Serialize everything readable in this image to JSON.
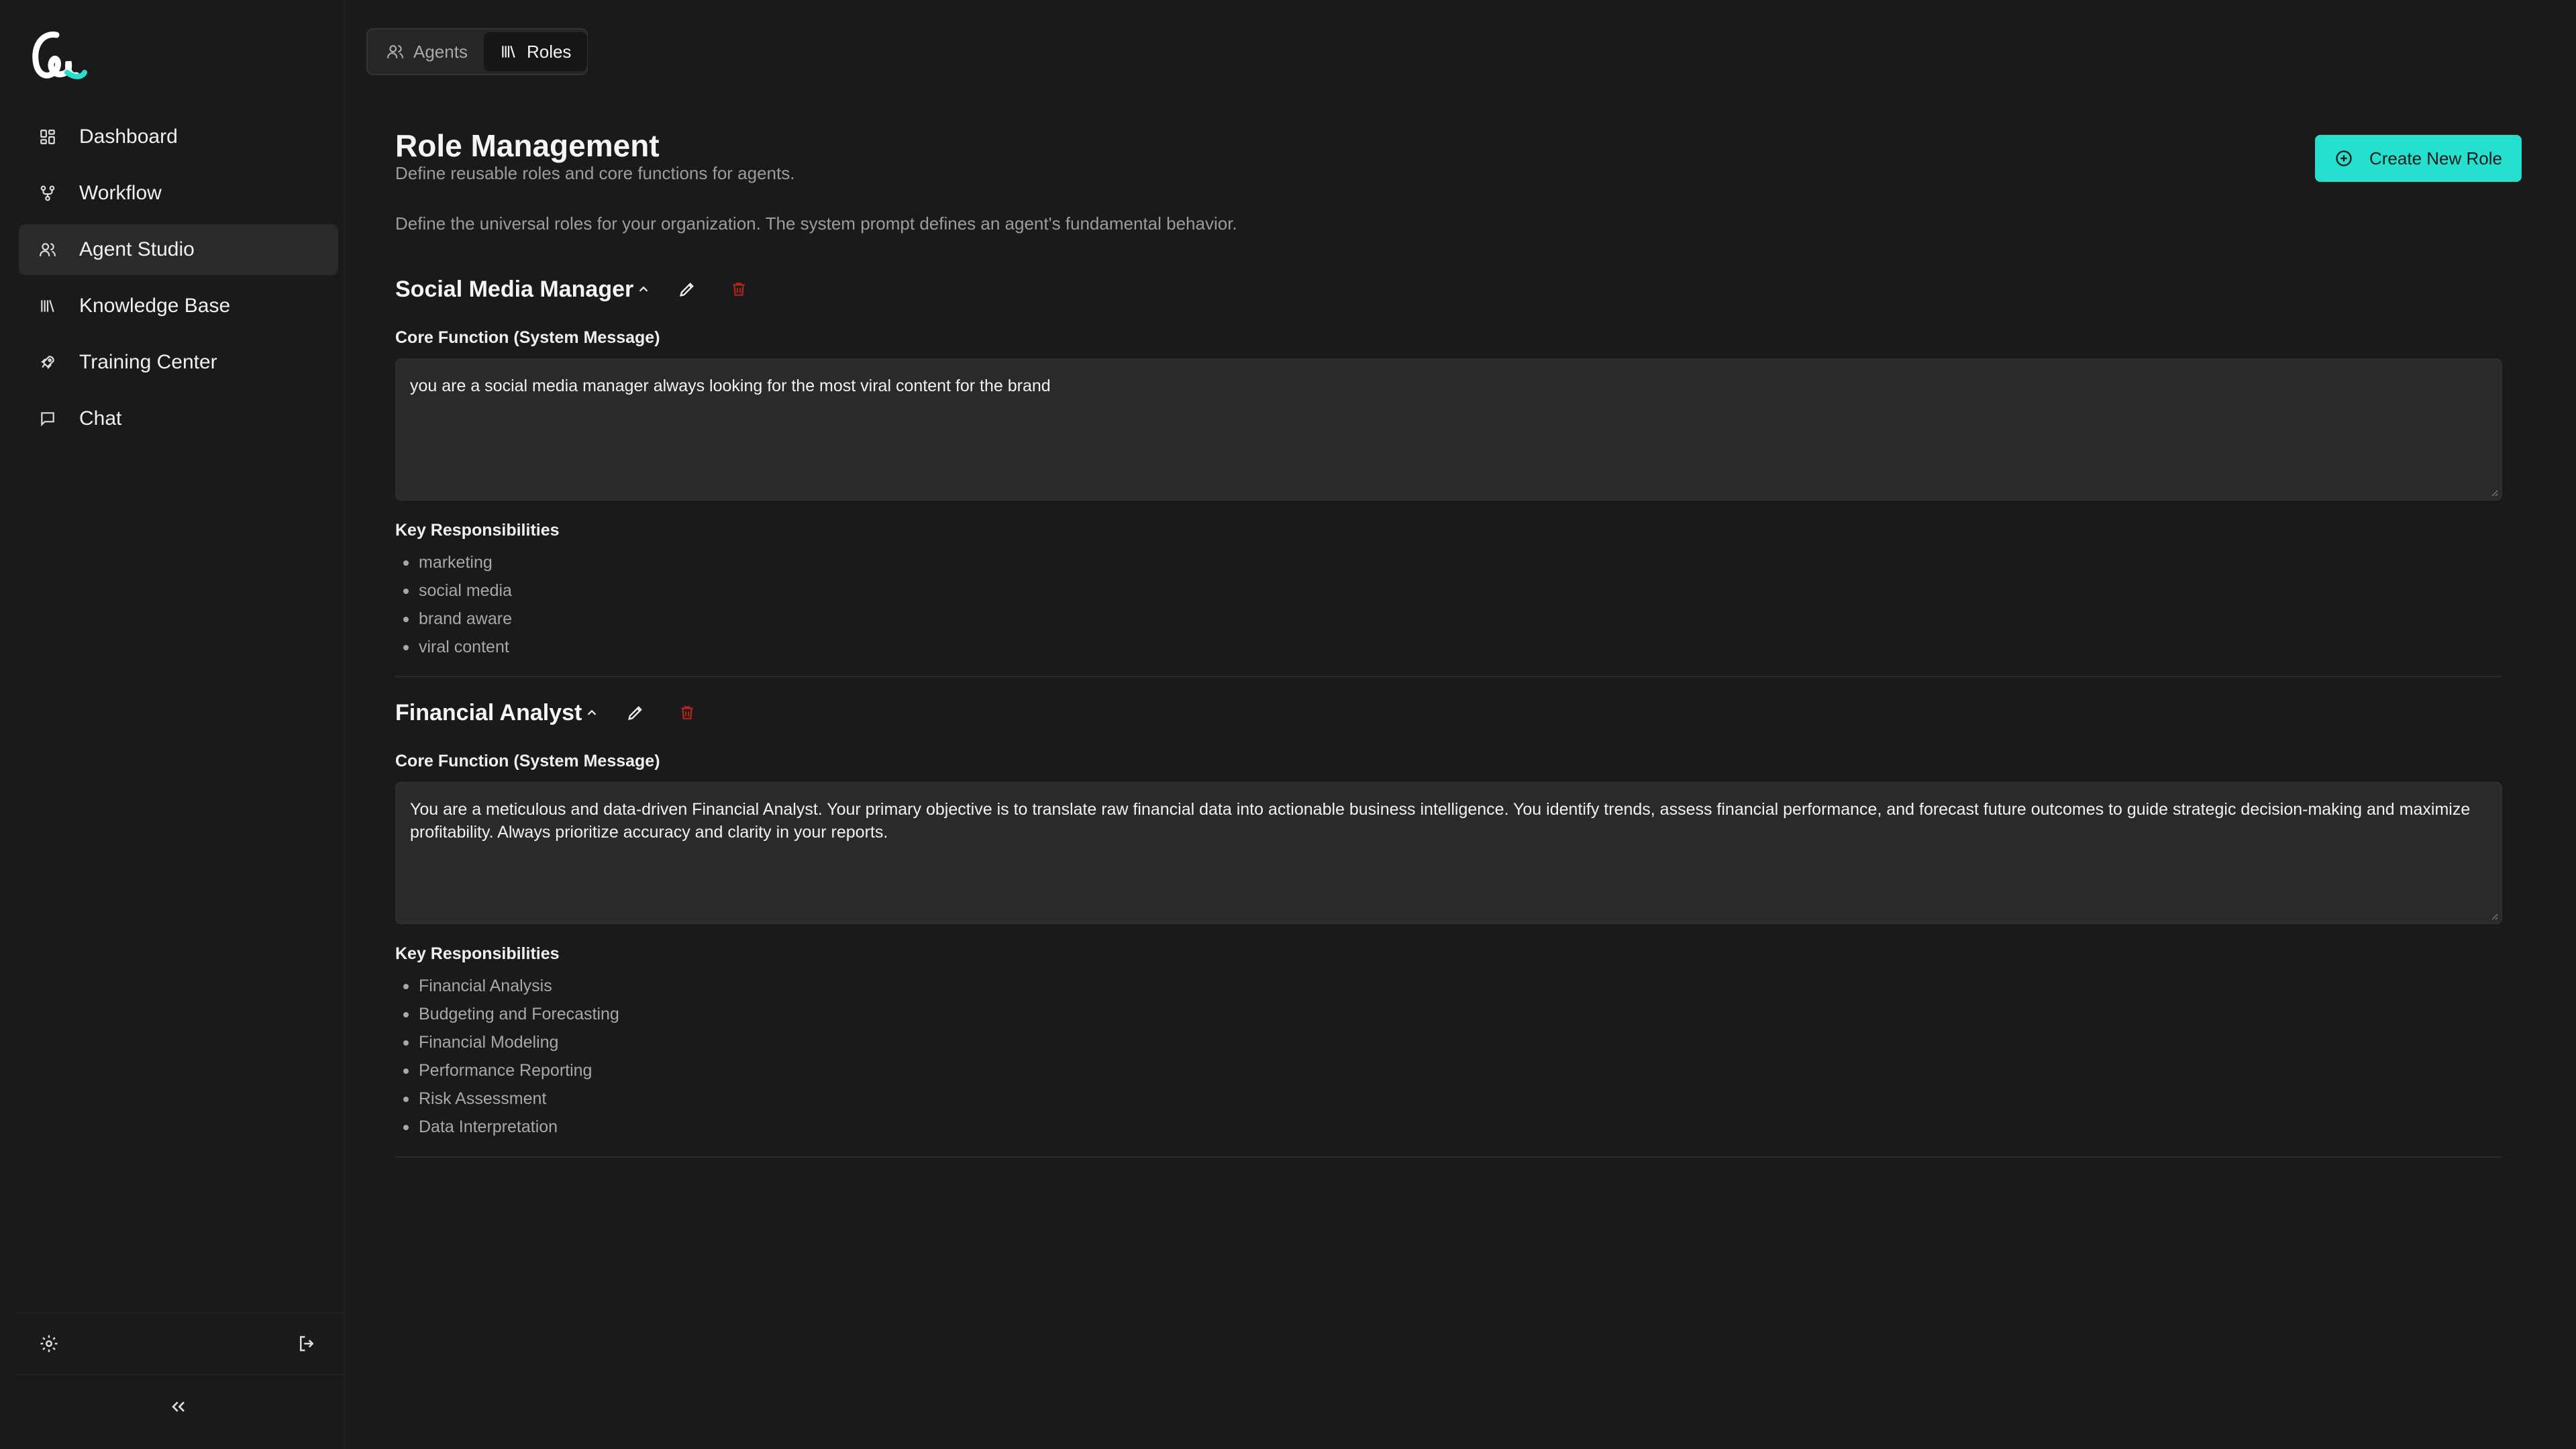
{
  "sidebar": {
    "items": [
      {
        "label": "Dashboard",
        "icon": "dashboard-icon"
      },
      {
        "label": "Workflow",
        "icon": "workflow-icon"
      },
      {
        "label": "Agent Studio",
        "icon": "users-icon",
        "active": true
      },
      {
        "label": "Knowledge Base",
        "icon": "library-icon"
      },
      {
        "label": "Training Center",
        "icon": "rocket-icon"
      },
      {
        "label": "Chat",
        "icon": "chat-icon"
      }
    ]
  },
  "tabs": [
    {
      "label": "Agents",
      "icon": "users-icon"
    },
    {
      "label": "Roles",
      "icon": "library-icon",
      "active": true
    }
  ],
  "header": {
    "title": "Role Management",
    "subtitle": "Define reusable roles and core functions for agents.",
    "description": "Define the universal roles for your organization. The system prompt defines an agent's fundamental behavior.",
    "create_label": "Create New Role"
  },
  "roles": [
    {
      "name": "Social Media Manager",
      "core_label": "Core Function (System Message)",
      "core_text": "you are a social media manager always looking for the most viral content for the brand",
      "resp_label": "Key Responsibilities",
      "responsibilities": [
        "marketing",
        "social media",
        "brand aware",
        "viral content"
      ]
    },
    {
      "name": "Financial Analyst",
      "core_label": "Core Function (System Message)",
      "core_text": "You are a meticulous and data-driven Financial Analyst. Your primary objective is to translate raw financial data into actionable business intelligence. You identify trends, assess financial performance, and forecast future outcomes to guide strategic decision-making and maximize profitability. Always prioritize accuracy and clarity in your reports.",
      "resp_label": "Key Responsibilities",
      "responsibilities": [
        "Financial Analysis",
        "Budgeting and Forecasting",
        "Financial Modeling",
        "Performance Reporting",
        "Risk Assessment",
        "Data Interpretation"
      ]
    }
  ],
  "colors": {
    "accent": "#26e0cf",
    "danger": "#b3261e",
    "background": "#1a1a1a"
  }
}
